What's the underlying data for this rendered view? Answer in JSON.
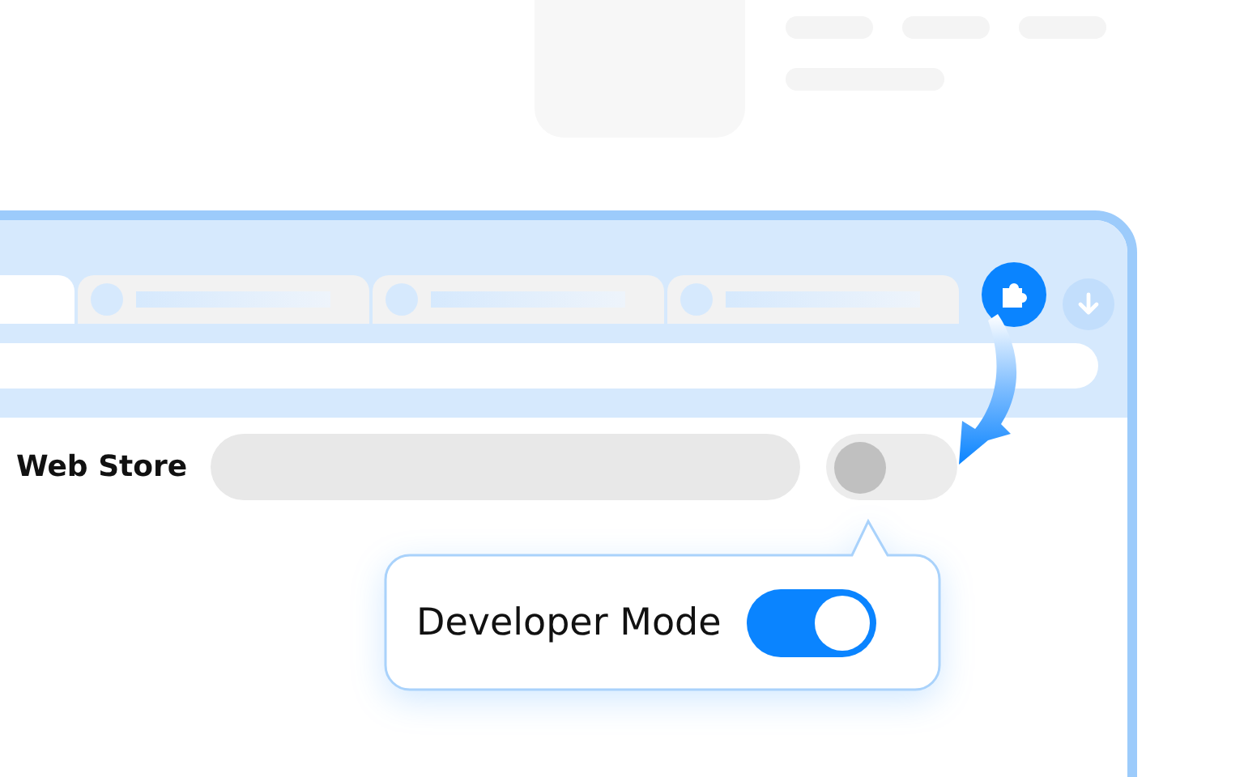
{
  "browser": {
    "tabs": [
      {
        "selected": true
      },
      {
        "selected": false
      },
      {
        "selected": false
      },
      {
        "selected": false
      }
    ]
  },
  "settings_row": {
    "label": "Web Store",
    "toggle": {
      "on": false
    }
  },
  "callout": {
    "label": "Developer Mode",
    "toggle": {
      "on": true
    }
  }
}
